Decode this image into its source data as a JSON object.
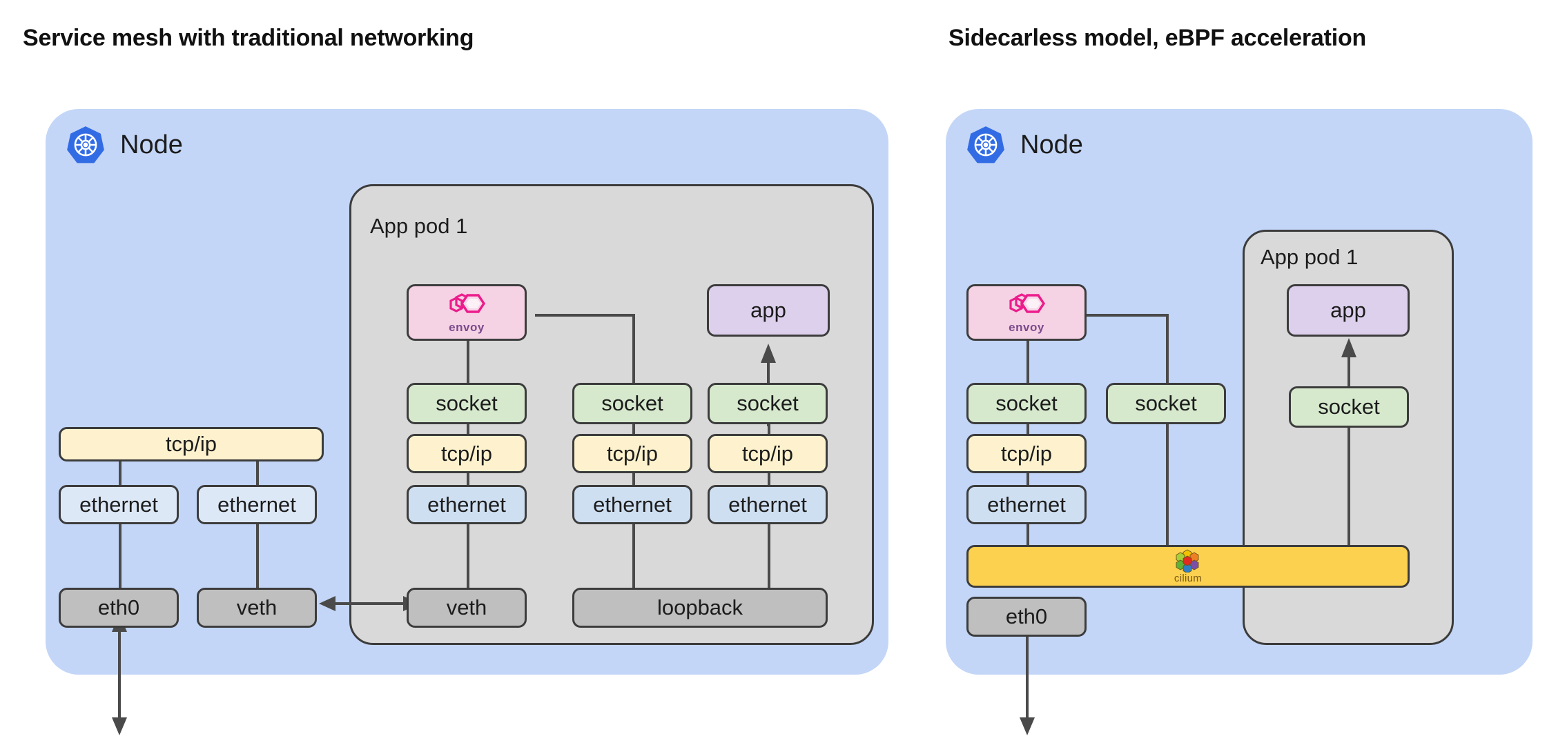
{
  "panels": [
    {
      "title": "Service mesh with traditional networking",
      "node_label": "Node",
      "node_icon": "kubernetes-icon",
      "pod_label": "App pod 1",
      "boxes": {
        "envoy": "envoy",
        "envoy_icon": "envoy-logo-icon",
        "app": "app",
        "socket": "socket",
        "tcpip": "tcp/ip",
        "ethernet": "ethernet",
        "eth0": "eth0",
        "veth": "veth",
        "loopback": "loopback"
      }
    },
    {
      "title": "Sidecarless model, eBPF acceleration",
      "node_label": "Node",
      "node_icon": "kubernetes-icon",
      "pod_label": "App pod 1",
      "boxes": {
        "envoy": "envoy",
        "envoy_icon": "envoy-logo-icon",
        "app": "app",
        "socket": "socket",
        "tcpip": "tcp/ip",
        "ethernet": "ethernet",
        "eth0": "eth0",
        "cilium": "cilium",
        "cilium_icon": "cilium-logo-icon"
      }
    }
  ],
  "colors": {
    "node_fill": "#c3d6f7",
    "pod_fill": "#d9d9d9",
    "socket_fill": "#d6e9cd",
    "tcpip_fill": "#fdf2cd",
    "ethernet_fill": "#cfdff2",
    "interface_fill": "#bfbfbf",
    "app_fill": "#ddd0ec",
    "envoy_fill": "#f5d2e4",
    "cilium_fill": "#fcd14f",
    "stroke": "#3c3c3c",
    "kubernetes_blue": "#326ce5",
    "envoy_pink": "#ec1c8b",
    "envoy_purple": "#7a4a8c"
  }
}
